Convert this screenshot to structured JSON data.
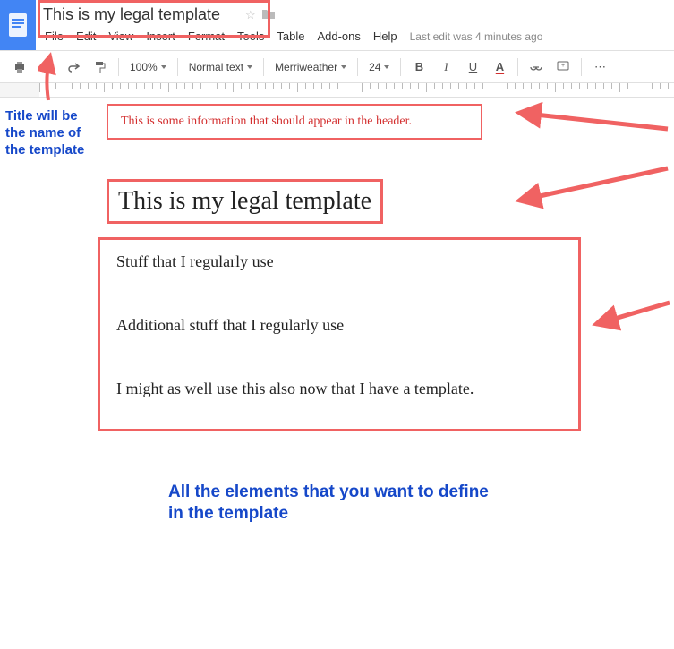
{
  "header": {
    "doc_title": "This is my legal template",
    "last_edit": "Last edit was 4 minutes ago",
    "menus": {
      "file": "File",
      "edit": "Edit",
      "view": "View",
      "insert": "Insert",
      "format": "Format",
      "tools": "Tools",
      "table": "Table",
      "addons": "Add-ons",
      "help": "Help"
    }
  },
  "toolbar": {
    "zoom": "100%",
    "style": "Normal text",
    "font": "Merriweather",
    "size": "24"
  },
  "document": {
    "header_text": "This is some information that should appear in the header.",
    "doc_heading": "This is my legal template",
    "body": {
      "p1": "Stuff that I regularly use",
      "p2": "Additional stuff that I regularly use",
      "p3": "I might as well use this also now that I have a template."
    }
  },
  "annotations": {
    "title_note": "Title will be the name of the template",
    "body_note": "All the elements that you want to define in the template"
  }
}
